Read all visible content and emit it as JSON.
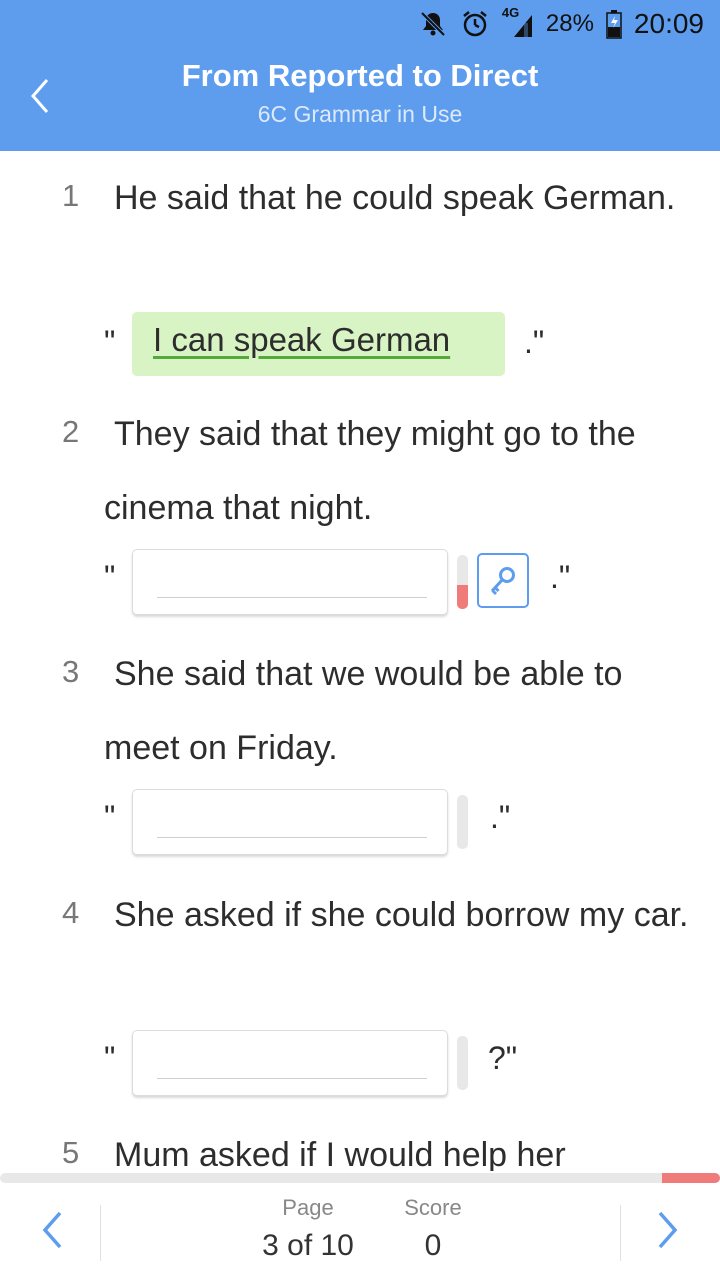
{
  "status_bar": {
    "network_label": "4G",
    "battery_percent": "28%",
    "time": "20:09",
    "icons": [
      "bell-off-icon",
      "alarm-icon",
      "signal-icon",
      "battery-icon"
    ]
  },
  "header": {
    "title": "From Reported to Direct",
    "subtitle": "6C Grammar in Use",
    "back_icon": "chevron-left-icon"
  },
  "questions": [
    {
      "number": "1",
      "text": "He said that he could speak German.",
      "open_quote": "\"",
      "answer": "I can speak German",
      "close_quote": ".\"",
      "state": "correct"
    },
    {
      "number": "2",
      "text": "They said that they might go to the cinema that night.",
      "open_quote": "\"",
      "answer": "",
      "close_quote": ".\"",
      "state": "hint",
      "meter_level": 0.45,
      "hint_icon": "key-icon"
    },
    {
      "number": "3",
      "text": "She said that we would be able to meet on Friday.",
      "open_quote": "\"",
      "answer": "",
      "close_quote": ".\"",
      "state": "empty",
      "meter_level": 0
    },
    {
      "number": "4",
      "text": "She asked if she could borrow my car.",
      "open_quote": "\"",
      "answer": "",
      "close_quote": "?\"",
      "state": "empty",
      "meter_level": 0
    },
    {
      "number": "5",
      "text": "Mum asked if I would help her"
    }
  ],
  "progress": {
    "fraction": 0.08
  },
  "footer": {
    "page_label": "Page",
    "page_value": "3 of 10",
    "score_label": "Score",
    "score_value": "0",
    "prev_icon": "chevron-left-icon",
    "next_icon": "chevron-right-icon"
  },
  "colors": {
    "header": "#5e9ded",
    "correct_bg": "#d8f3c4",
    "meter": "#ef7b7b",
    "accent": "#5e9ded"
  }
}
